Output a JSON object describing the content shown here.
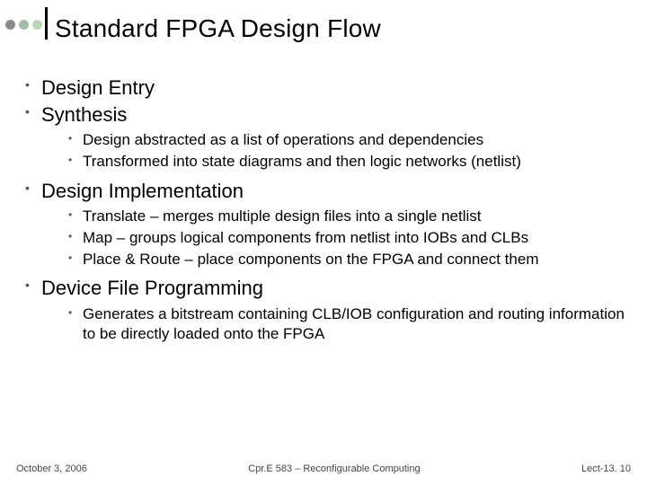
{
  "header": {
    "title": "Standard FPGA Design Flow",
    "dot_colors": [
      "#8a8a8a",
      "#9fbf9f",
      "#b8d8b8"
    ]
  },
  "bullets": [
    {
      "text": "Design Entry",
      "sub": []
    },
    {
      "text": "Synthesis",
      "sub": [
        {
          "text": "Design abstracted as a list of operations and dependencies"
        },
        {
          "text": "Transformed into state diagrams and then logic networks (netlist)"
        }
      ]
    },
    {
      "text": "Design Implementation",
      "sub": [
        {
          "text": "Translate – merges multiple design files into a single netlist"
        },
        {
          "text": "Map – groups logical components from netlist into IOBs and CLBs"
        },
        {
          "text": "Place & Route – place components on the FPGA and connect them"
        }
      ]
    },
    {
      "text": "Device File Programming",
      "sub": [
        {
          "text": "Generates a bitstream containing CLB/IOB configuration and routing information to be directly loaded onto the FPGA"
        }
      ]
    }
  ],
  "footer": {
    "left": "October 3, 2006",
    "center": "Cpr.E 583 – Reconfigurable Computing",
    "right": "Lect-13. 10"
  }
}
